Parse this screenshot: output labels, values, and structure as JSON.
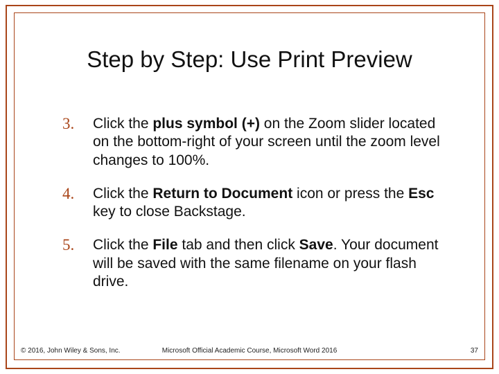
{
  "title": "Step by Step: Use Print Preview",
  "items": [
    {
      "n": "3.",
      "parts": [
        {
          "t": "Click the "
        },
        {
          "t": "plus symbol (+)",
          "b": true
        },
        {
          "t": " on the Zoom slider located on the bottom-right of your screen until the zoom level changes to 100%."
        }
      ]
    },
    {
      "n": "4.",
      "parts": [
        {
          "t": "Click the "
        },
        {
          "t": "Return to Document",
          "b": true
        },
        {
          "t": " icon or press the "
        },
        {
          "t": "Esc",
          "b": true
        },
        {
          "t": " key to close Backstage."
        }
      ]
    },
    {
      "n": "5.",
      "parts": [
        {
          "t": "Click the "
        },
        {
          "t": "File",
          "b": true
        },
        {
          "t": " tab and then click "
        },
        {
          "t": "Save",
          "b": true
        },
        {
          "t": ". Your document will be saved with the same filename on your flash drive."
        }
      ]
    }
  ],
  "footer": {
    "left": "© 2016, John Wiley & Sons, Inc.",
    "center": "Microsoft Official Academic Course, Microsoft Word 2016",
    "right": "37"
  }
}
